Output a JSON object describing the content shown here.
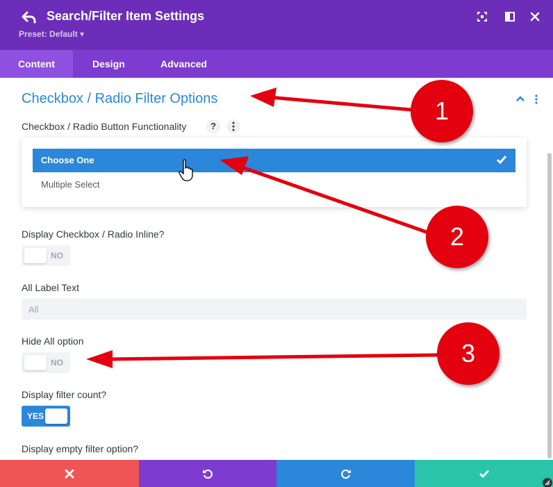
{
  "header": {
    "title": "Search/Filter Item Settings",
    "preset": "Preset: Default ▾"
  },
  "tabs": [
    {
      "label": "Content",
      "active": true
    },
    {
      "label": "Design",
      "active": false
    },
    {
      "label": "Advanced",
      "active": false
    }
  ],
  "section": {
    "title": "Checkbox / Radio Filter Options"
  },
  "functionality": {
    "label": "Checkbox / Radio Button Functionality",
    "help": "?",
    "options": [
      "Choose One",
      "Multiple Select"
    ],
    "selected": "Choose One"
  },
  "fields": {
    "inline_label": "Display Checkbox / Radio Inline?",
    "inline_value": "NO",
    "all_label_text_label": "All Label Text",
    "all_label_text_placeholder": "All",
    "hide_all_label": "Hide All option",
    "hide_all_value": "NO",
    "filter_count_label": "Display filter count?",
    "filter_count_value": "YES",
    "empty_option_label": "Display empty filter option?"
  },
  "footer": {
    "colors": {
      "cancel": "#ef5555",
      "undo": "#7e3bd0",
      "redo": "#2b87da",
      "save": "#29c4a9"
    }
  },
  "annotations": {
    "badges": [
      "1",
      "2",
      "3"
    ],
    "color": "#e3000f"
  },
  "colors": {
    "header": "#6c2eb9",
    "tabs": "#7e3bd0",
    "accent": "#2b87da"
  }
}
